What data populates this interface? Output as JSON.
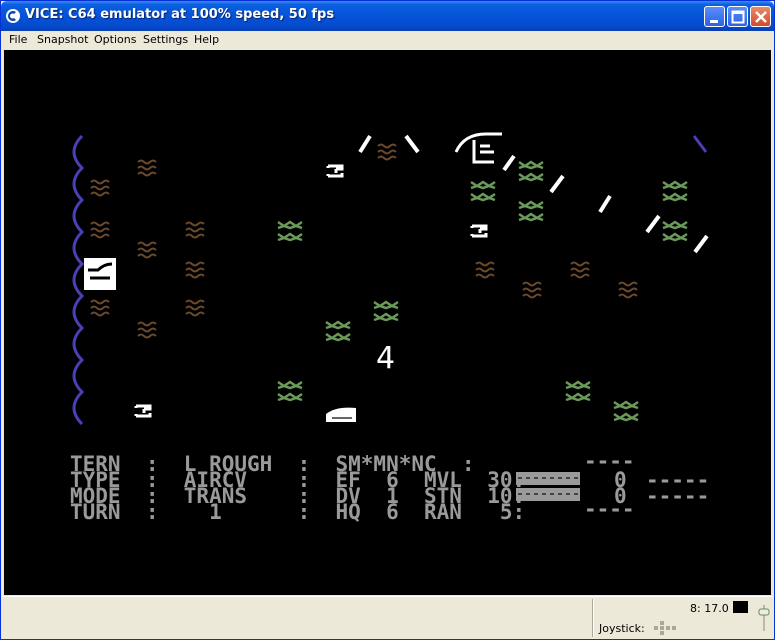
{
  "window": {
    "title": "VICE: C64 emulator at 100% speed, 50 fps"
  },
  "menu": {
    "items": [
      "File",
      "Snapshot",
      "Options",
      "Settings",
      "Help"
    ]
  },
  "game": {
    "map_number": "4",
    "status_lines": [
      "TERN  :  L ROUGH  :  SM*MN*NC  :",
      "TYPE  :  AIRCV    :  EF  6  MVL  30:",
      "MODE  :  TRANS    :  DV  1  STN  10:",
      "TURN  :    1      :  HQ  6  RAN   5:"
    ],
    "dashes_top": "----",
    "value_1": "0",
    "value_2": "0",
    "dashes_right_1": "-----",
    "dashes_right_2": "-----",
    "dashes_bottom": "----"
  },
  "status": {
    "speed_text": "8: 17.0",
    "joystick_label": "Joystick:"
  },
  "colors": {
    "titlebar": "#0653d8",
    "screen_bg": "#000000",
    "river": "#4a3fb6",
    "rough": "#6b4a2a",
    "forest": "#6a9a5a",
    "unit": "#ffffff",
    "text": "#9a9a9a"
  }
}
